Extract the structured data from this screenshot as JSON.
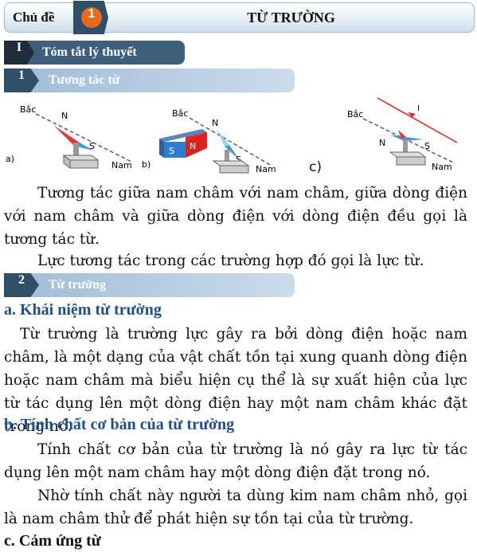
{
  "topic": {
    "label": "Chủ đề",
    "number": "1",
    "title": "TỪ TRƯỜNG"
  },
  "section1": {
    "roman": "I",
    "title": "Tóm tắt lý thuyết"
  },
  "sub1": {
    "number": "1",
    "title": "Tương tác từ"
  },
  "figures": {
    "north": "Bắc",
    "south": "Nam",
    "n": "N",
    "s": "S",
    "i": "I",
    "label_a": "a)",
    "label_b": "b)",
    "label_c": "c)",
    "magnet_s": "S",
    "magnet_n": "N"
  },
  "paragraphs": {
    "p1": "Tương tác giữa nam châm với nam châm, giữa dòng điện với nam châm và giữa dòng điện với dòng điện đều gọi là tương tác từ.",
    "p2": "Lực tương tác trong các trường hợp đó gọi là lực từ.",
    "p3": "Từ trường là trường lực gây ra bởi dòng điện hoặc nam châm, là một dạng của vật chất tồn tại xung quanh dòng điện hoặc nam châm mà biểu hiện cụ thể là sự xuất hiện của lực từ tác dụng lên một dòng điện hay một nam châm khác đặt trong nó.",
    "p4": "Tính chất cơ bản của từ trường là nó gây ra lực từ tác dụng lên một nam châm hay một dòng điện đặt trong nó.",
    "p5": "Nhờ tính chất này người ta dùng kim nam châm nhỏ, gọi là nam châm thử để phát hiện sự tồn tại của từ trường."
  },
  "sub2": {
    "number": "2",
    "title": "Từ trường"
  },
  "headings": {
    "a": "a. Khái niệm từ trường",
    "b": "b. Tính chất cơ bản của từ trường",
    "c": "c. Cảm ứng từ"
  }
}
